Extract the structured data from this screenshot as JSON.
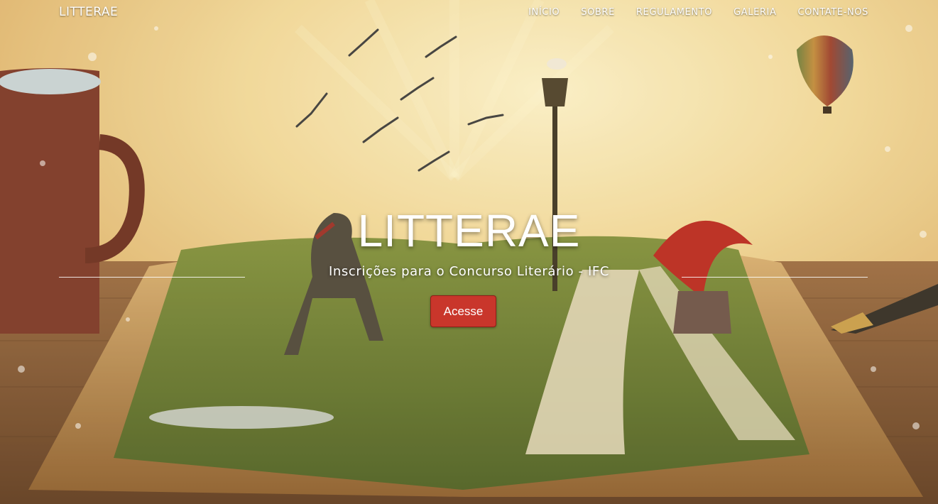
{
  "navbar": {
    "brand": "LITTERAE",
    "links": [
      "INÍCIO",
      "SOBRE",
      "REGULAMENTO",
      "GALERIA",
      "CONTATE-NOS"
    ]
  },
  "hero": {
    "title": "LITTERAE",
    "subtitle": "Inscrições para o Concurso Literário - IFC",
    "cta_label": "Acesse"
  },
  "colors": {
    "cta": "#c9362b",
    "text": "#ffffff"
  }
}
